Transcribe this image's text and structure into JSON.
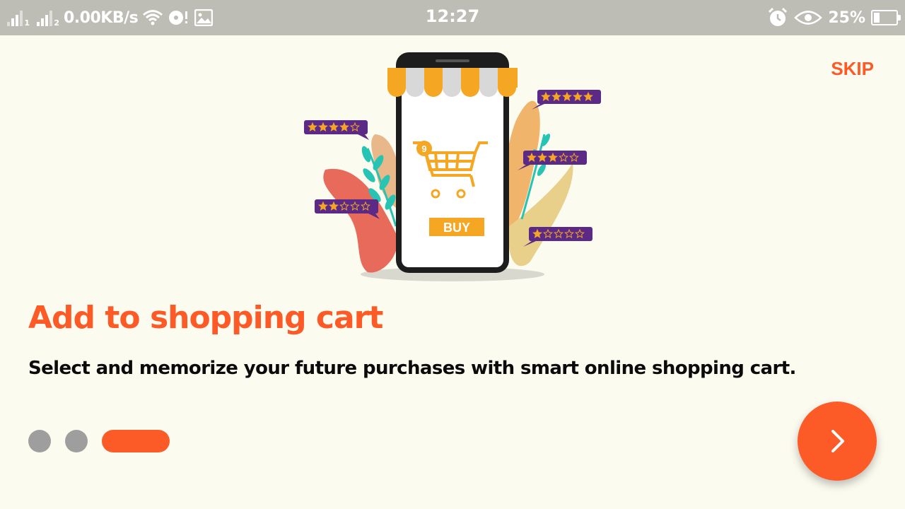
{
  "status_bar": {
    "sim1": "1",
    "sim2": "2",
    "network_speed": "0.00KB/s",
    "time": "12:27",
    "battery_percent": "25%",
    "battery_level": 0.25,
    "icons": [
      "signal-icon",
      "wifi-icon",
      "sync-alert-icon",
      "image-icon",
      "alarm-icon",
      "eye-icon",
      "battery-icon"
    ]
  },
  "onboarding": {
    "skip_label": "SKIP",
    "title": "Add to shopping cart",
    "description": "Select and memorize your future purchases with smart online shopping cart.",
    "illustration": {
      "cart_badge": "9",
      "buy_label": "BUY",
      "ratings": [
        4,
        5,
        2,
        3,
        1
      ]
    },
    "page_count": 3,
    "active_page": 3,
    "next_icon": "chevron-right-icon"
  },
  "colors": {
    "accent": "#fc5b27",
    "background": "#fcfbef",
    "status_bar": "#bebdb5",
    "inactive_dot": "#9e9e9e",
    "rating_bubble": "#5b2a86",
    "star": "#f5a623"
  }
}
